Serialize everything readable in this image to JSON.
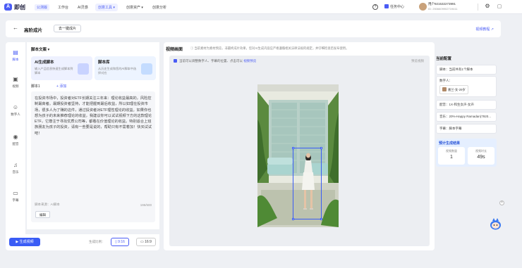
{
  "header": {
    "logo_text": "A",
    "brand": "即创",
    "brand_badge": "公测版",
    "nav": [
      "工作台",
      "AI灵感",
      "创意工具",
      "创意资产",
      "创意分析"
    ],
    "nav_active_index": 2,
    "help_icon": "question-icon",
    "task_center": "任务中心",
    "username": "用户921532273991",
    "user_id": "ID: 2506609902719411",
    "settings_icon": "gear-icon",
    "collapse_icon": "collapse-icon"
  },
  "subheader": {
    "back_icon": "arrow-left-icon",
    "title": "高阶成片",
    "onekey_button": "去一键成片",
    "tutorial_link": "视频教程"
  },
  "rail": [
    {
      "icon": "script-icon",
      "label": "脚本",
      "active": true
    },
    {
      "icon": "video-icon",
      "label": "视频",
      "active": false
    },
    {
      "icon": "person-icon",
      "label": "数字人",
      "active": false
    },
    {
      "icon": "dubbing-icon",
      "label": "配音",
      "active": false
    },
    {
      "icon": "music-icon",
      "label": "音乐",
      "active": false
    },
    {
      "icon": "subtitle-icon",
      "label": "字幕",
      "active": false
    }
  ],
  "script_panel": {
    "title": "脚本文案",
    "cards": [
      {
        "title": "AI生成脚本",
        "desc": "输入产品信息快速生成脚本到脚本",
        "icon": "ai-script-icon"
      },
      {
        "title": "脚本库",
        "desc": "从历史生成和您的AI脚本中选择对应",
        "icon": "library-search-icon"
      }
    ],
    "tab": "脚本1",
    "add": "添加",
    "text": "在投资市场中，投资者对ETF长期关注三年来：理论收益最高的，风险控制最高者。最期投资者坚持，才能把握到最后收益，所以如理在投资市场，很多人为了赚的这件，通过投资者对ETF理性理论的收益。如果你也想为孩子的未来推荐理论的收益，我建议你可以试试视频下方的这款理论ETF，它尊注于寻找优质公司等，都看在价值理论的收益。特别适合上班族朋友为孩子的投资，请有一些要是说的，帮助只有不需着加！快买试试吧！",
    "source_label": "脚本来源：AI脚本",
    "counter": "195/500",
    "edit_button": "编辑"
  },
  "left_bottom": {
    "generate_button": "生成视频",
    "ratio_label": "生成比例：",
    "ratios": [
      "9:16",
      "16:9"
    ],
    "ratio_selected": 0
  },
  "main": {
    "title": "视频画面",
    "description": "当前素材为素材预览，非最终成片效果，您对AI生成内容应严格遵循相关法律法规的规定，并仔细检查后发布使用。",
    "hint_text": "当前可以调整数字人、字幕的位置、点击可以",
    "hint_link": "视频预览",
    "preview_link": "预览视频"
  },
  "config": {
    "title": "当前配置",
    "script": "脚本：当前共有1个脚本",
    "avatar_label": "数字人：",
    "avatar_name": "嘉兰-女-29岁",
    "voice": "配音：1X-和生女声-女声",
    "music": "音乐：20%-Happy Ramadan(7920...",
    "subtitle": "字幕：脚本字幕"
  },
  "result": {
    "title": "预计生成结果",
    "count_label": "视频数量",
    "count": "1",
    "duration_label": "视频时长",
    "duration": "49s"
  },
  "colors": {
    "accent": "#4a5cf5",
    "button": "#3a5cf5",
    "result_bg": "#e5efff"
  }
}
